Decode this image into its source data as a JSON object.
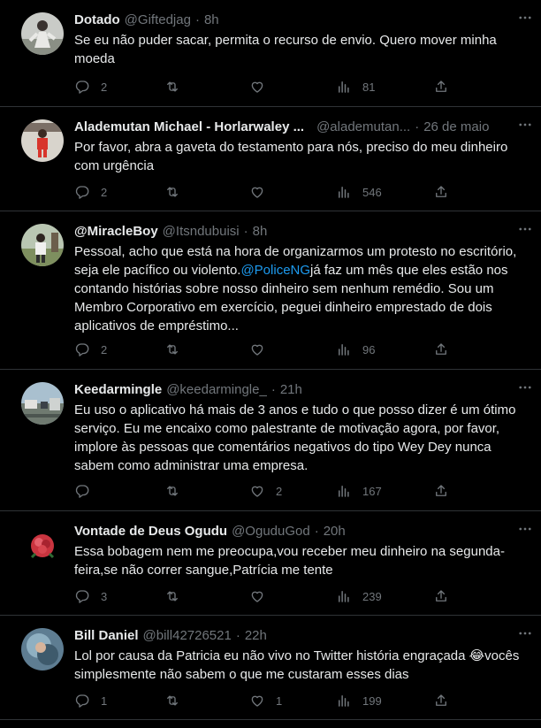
{
  "tweets": [
    {
      "name": "Dotado",
      "handle": "@Giftedjag",
      "time": "8h",
      "text": "Se eu não puder sacar, permita o recurso de envio. Quero mover minha moeda",
      "replies": "2",
      "retweets": "",
      "likes": "",
      "views": "81"
    },
    {
      "name": "Alademutan Michael - Horlarwaley ...",
      "handle": "@alademutan...",
      "time": "26 de maio",
      "text": "Por favor, abra a gaveta do testamento para nós, preciso do meu dinheiro com urgência",
      "replies": "2",
      "retweets": "",
      "likes": "",
      "views": "546"
    },
    {
      "name": "@MiracleBoy",
      "handle": "@Itsndubuisi",
      "time": "8h",
      "text_before": "Pessoal, acho que está na hora de organizarmos um protesto no escritório, seja ele pacífico ou violento.",
      "mention": "@PoliceNG",
      "text_after": "já faz um mês que eles estão nos contando histórias sobre nosso dinheiro sem nenhum remédio. Sou um Membro Corporativo em exercício, peguei dinheiro emprestado de dois aplicativos de empréstimo...",
      "replies": "2",
      "retweets": "",
      "likes": "",
      "views": "96"
    },
    {
      "name": "Keedarmingle",
      "handle": "@keedarmingle_",
      "time": "21h",
      "text": "Eu uso o aplicativo há mais de 3 anos e tudo o que posso dizer é um ótimo serviço. Eu me encaixo como palestrante de motivação agora, por favor, implore às pessoas que comentários negativos do tipo Wey Dey nunca sabem como administrar uma empresa.",
      "replies": "",
      "retweets": "",
      "likes": "2",
      "views": "167"
    },
    {
      "name": "Vontade de Deus Ogudu",
      "handle": "@OguduGod",
      "time": "20h",
      "text": "Essa bobagem nem me preocupa,vou receber meu dinheiro na segunda-feira,se não correr sangue,Patrícia me tente",
      "replies": "3",
      "retweets": "",
      "likes": "",
      "views": "239"
    },
    {
      "name": "Bill Daniel",
      "handle": "@bill42726521",
      "time": "22h",
      "text": "Lol por causa da Patricia eu não vivo no Twitter história engraçada 😂vocês simplesmente não sabem o que me custaram esses dias",
      "replies": "1",
      "retweets": "",
      "likes": "1",
      "views": "199"
    }
  ],
  "colors": {
    "background": "#000000",
    "text": "#e7e9ea",
    "muted": "#71767b",
    "link": "#1d9bf0",
    "divider": "#2f3336"
  },
  "icons": [
    "reply-icon",
    "retweet-icon",
    "like-icon",
    "views-icon",
    "share-icon",
    "more-icon"
  ]
}
